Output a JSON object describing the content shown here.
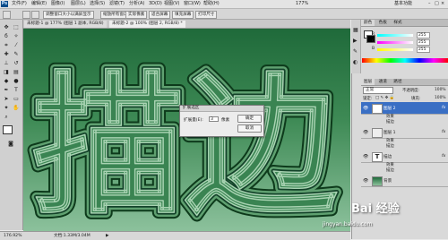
{
  "menubar": {
    "app_icon": "Ps",
    "items": [
      "文件(F)",
      "编辑(E)",
      "图像(I)",
      "图层(L)",
      "选择(S)",
      "滤镜(T)",
      "分析(A)",
      "3D(D)",
      "视图(V)",
      "窗口(W)",
      "帮助(H)"
    ],
    "zoom": "177%",
    "workspace": "基本功能"
  },
  "options": {
    "btn1": "调整窗口大小以满屏显示",
    "btn2": "缩放所有窗口",
    "btn3": "实际像素",
    "btn4": "适合屏幕",
    "btn5": "填充屏幕",
    "btn6": "打印尺寸"
  },
  "document": {
    "tab1": "未标题-1 @ 177% (图层 1 副本, RGB/8)",
    "tab2": "未标题-2 @ 100% (图层 2, RGB/8) *"
  },
  "dialog": {
    "title": "扩展选区",
    "label": "扩展量(E):",
    "value": "3",
    "unit": "像素",
    "ok": "确定",
    "cancel": "取消"
  },
  "canvas_text": "描边",
  "status": {
    "zoom": "176.92%",
    "doc": "文档:1.33M/3.04M"
  },
  "color_panel": {
    "tab1": "颜色",
    "tab2": "色板",
    "tab3": "样式",
    "r_label": "R",
    "g_label": "G",
    "b_label": "B",
    "r": "255",
    "g": "255",
    "b": "255"
  },
  "layers_panel": {
    "tab1": "图层",
    "tab2": "通道",
    "tab3": "路径",
    "blend_mode": "正常",
    "opacity_label": "不透明度:",
    "opacity": "100%",
    "lock_label": "锁定:",
    "fill_label": "填充:",
    "fill": "100%",
    "layers": [
      {
        "name": "图层 2",
        "fx": "fx"
      },
      {
        "name": "图层 1",
        "fx": "fx"
      },
      {
        "name": "描边",
        "fx": "fx"
      },
      {
        "name": "背景",
        "fx": ""
      }
    ],
    "effects_label": "效果",
    "stroke_label": "描边"
  },
  "watermark": "Bai 经验",
  "watermark_url": "jingyan.baidu.com"
}
